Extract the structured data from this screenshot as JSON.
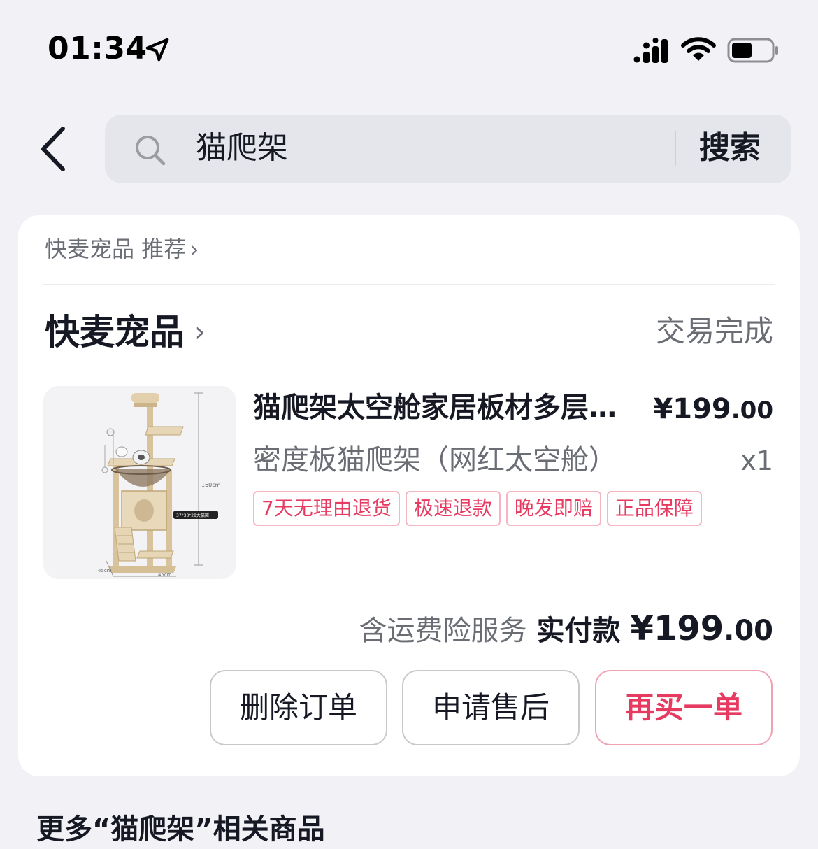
{
  "status_bar": {
    "time": "01:34"
  },
  "search": {
    "back_icon": "chevron-left-icon",
    "query": "猫爬架",
    "button_label": "搜索"
  },
  "recommendation": {
    "label": "快麦宠品 推荐",
    "chevron": "›"
  },
  "order": {
    "shop_name": "快麦宠品",
    "shop_chevron": "›",
    "status": "交易完成",
    "product": {
      "title": "猫爬架太空舱家居板材多层豪华别墅",
      "price_int": "¥199",
      "price_dec": ".00",
      "spec": "密度板猫爬架（网红太空舱）",
      "quantity": "x1",
      "image_caption_height": "160cm",
      "image_caption_width_left": "45cm",
      "image_caption_width_right": "45cm",
      "image_caption_cabin": "37*33*28大猫窝"
    },
    "tags": [
      "7天无理由退货",
      "极速退款",
      "晚发即赔",
      "正品保障"
    ],
    "service_note": "含运费险服务",
    "paid_label": "实付款",
    "paid_int": "¥199",
    "paid_dec": ".00",
    "buttons": {
      "delete": "删除订单",
      "after_sale": "申请售后",
      "rebuy": "再买一单"
    }
  },
  "more_section": {
    "title": "更多“猫爬架”相关商品"
  },
  "colors": {
    "accent": "#e63a61",
    "background": "#f2f2f6"
  }
}
